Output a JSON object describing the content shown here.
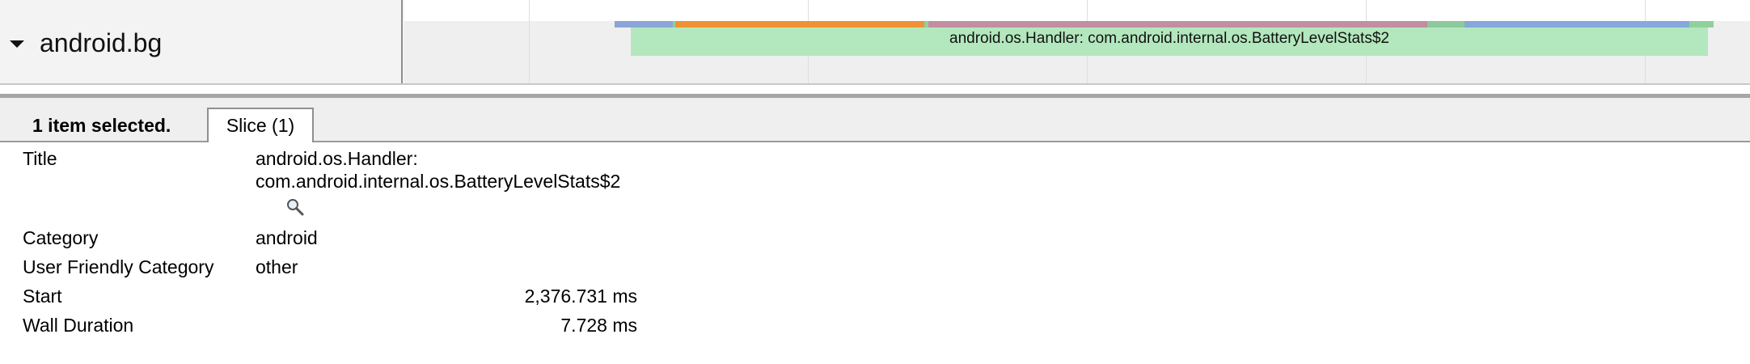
{
  "track": {
    "name": "android.bg",
    "slice_label": "android.os.Handler: com.android.internal.os.BatteryLevelStats$2",
    "slice_color": "#b3e7bd",
    "segment_colors": [
      "#8aa5d6",
      "#8fd19b",
      "#ef9233",
      "#b88a9a",
      "#c38ea0",
      "#8cc99c",
      "#86a8dc",
      "#8fd19b"
    ]
  },
  "details": {
    "selection_text": "1 item selected.",
    "tab_label": "Slice (1)",
    "rows": [
      {
        "label": "Title",
        "value": "android.os.Handler:",
        "value2": "com.android.internal.os.BatteryLevelStats$2"
      },
      {
        "label": "Category",
        "value": "android"
      },
      {
        "label": "User Friendly Category",
        "value": "other"
      },
      {
        "label": "Start",
        "value": "2,376.731 ms"
      },
      {
        "label": "Wall Duration",
        "value": "7.728 ms"
      }
    ]
  },
  "icons": {
    "expander": "triangle-down-icon",
    "search": "magnifier-icon"
  }
}
